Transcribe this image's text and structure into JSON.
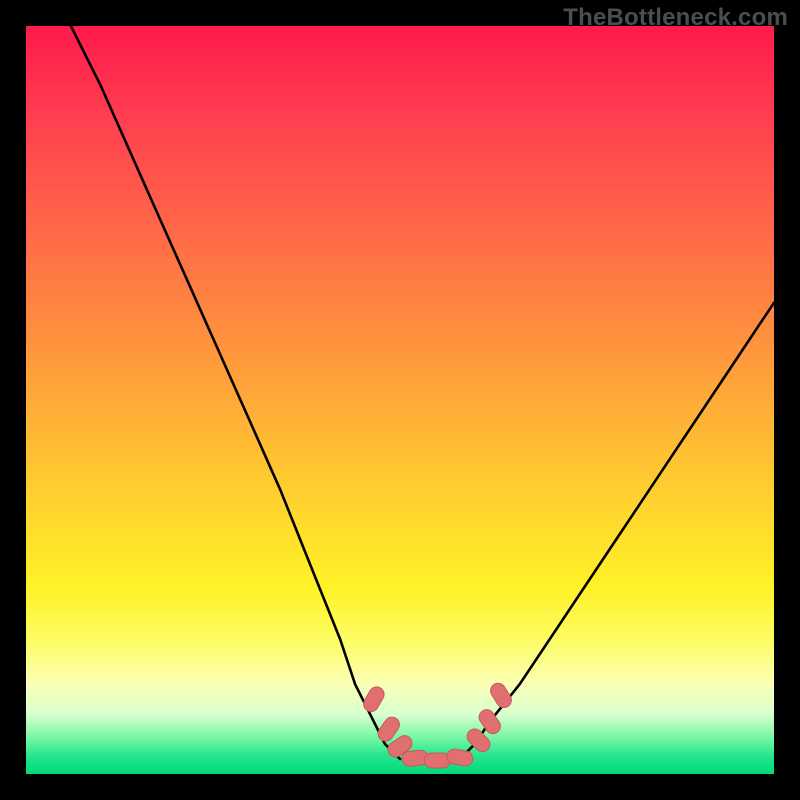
{
  "watermark": {
    "text": "TheBottleneck.com"
  },
  "chart_data": {
    "type": "line",
    "title": "",
    "xlabel": "",
    "ylabel": "",
    "xlim": [
      0,
      100
    ],
    "ylim": [
      0,
      100
    ],
    "series": [
      {
        "name": "left-curve",
        "x": [
          6,
          10,
          14,
          18,
          22,
          26,
          30,
          34,
          38,
          42,
          44,
          46,
          48,
          50
        ],
        "y": [
          100,
          92,
          83,
          74,
          65,
          56,
          47,
          38,
          28,
          18,
          12,
          8,
          4,
          2
        ]
      },
      {
        "name": "right-curve",
        "x": [
          58,
          60,
          62,
          66,
          70,
          74,
          78,
          82,
          86,
          90,
          94,
          98,
          100
        ],
        "y": [
          2,
          4,
          7,
          12,
          18,
          24,
          30,
          36,
          42,
          48,
          54,
          60,
          63
        ]
      }
    ],
    "markers": [
      {
        "name": "bead-left-1",
        "x": 46.5,
        "y": 10.0,
        "rot": -60
      },
      {
        "name": "bead-left-2",
        "x": 48.5,
        "y": 6.0,
        "rot": -55
      },
      {
        "name": "bead-left-3",
        "x": 50.0,
        "y": 3.7,
        "rot": -35
      },
      {
        "name": "bead-bottom-1",
        "x": 52.0,
        "y": 2.1,
        "rot": -5
      },
      {
        "name": "bead-bottom-2",
        "x": 55.0,
        "y": 1.8,
        "rot": 0
      },
      {
        "name": "bead-bottom-3",
        "x": 58.0,
        "y": 2.2,
        "rot": 10
      },
      {
        "name": "bead-right-1",
        "x": 60.5,
        "y": 4.5,
        "rot": 45
      },
      {
        "name": "bead-right-2",
        "x": 62.0,
        "y": 7.0,
        "rot": 55
      },
      {
        "name": "bead-right-3",
        "x": 63.5,
        "y": 10.5,
        "rot": 58
      }
    ],
    "colors": {
      "curve": "#000000",
      "marker_fill": "#e06f6f",
      "marker_stroke": "#c95a5a"
    }
  }
}
